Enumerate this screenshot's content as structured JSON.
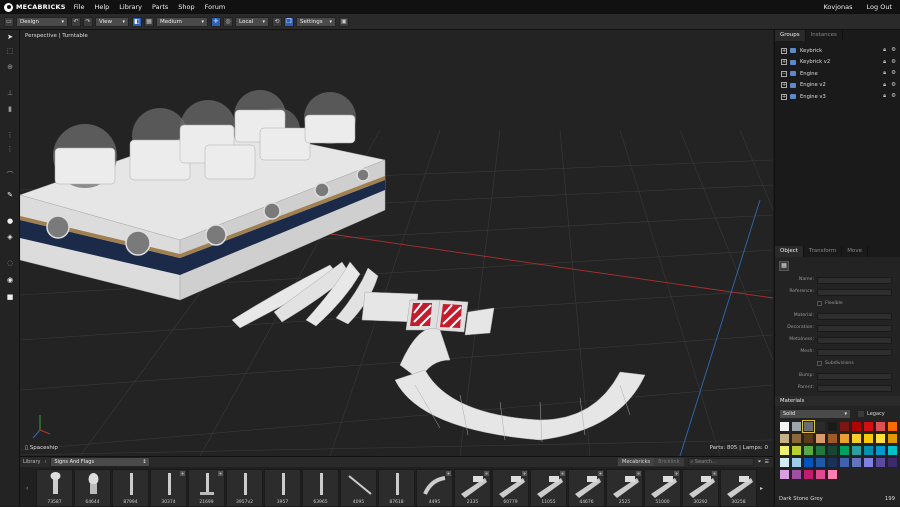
{
  "app": {
    "name": "MECABRICKS"
  },
  "menu": {
    "items": [
      "File",
      "Help",
      "Library",
      "Parts",
      "Shop",
      "Forum"
    ],
    "user": "Kovjonas",
    "logout": "Log Out"
  },
  "toolbar": {
    "mode": "Design",
    "view": "View",
    "quality": "Medium",
    "space": "Local",
    "settings": "Settings"
  },
  "viewport": {
    "label": "Perspective | Turntable",
    "model_name": "Spaceship",
    "stats": "Parts: 805 | Lamps: 0"
  },
  "groups": {
    "tabs": [
      "Groups",
      "Instances"
    ],
    "items": [
      {
        "label": "Keybrick",
        "expand": "+"
      },
      {
        "label": "Keybrick v2",
        "expand": "+"
      },
      {
        "label": "Engine",
        "expand": "−"
      },
      {
        "label": "Engine v2",
        "expand": "+"
      },
      {
        "label": "Engine v3",
        "expand": "+"
      }
    ]
  },
  "object": {
    "tabs": [
      "Object",
      "Transform",
      "Move"
    ],
    "fields": [
      "Name:",
      "Reference:",
      "Flexible",
      "Material:",
      "Decoration:",
      "Metalness:",
      "Mesh:",
      "Subdivisions",
      "Bump:",
      "Parent:"
    ]
  },
  "materials": {
    "title": "Materials",
    "mode": "Solid",
    "legacy": "Legacy",
    "selected_name": "Dark Stone Grey",
    "selected_count": "199",
    "colors": [
      "#f4f4f4",
      "#a0a5a9",
      "#6b6e70",
      "#2b2b2b",
      "#1b1b1b",
      "#7b1712",
      "#b40000",
      "#d01012",
      "#e05050",
      "#ff6a00",
      "#c7b08a",
      "#8a6a3a",
      "#5a3a1a",
      "#d79a6a",
      "#a05a2a",
      "#e8a030",
      "#f5cd2f",
      "#fac80a",
      "#ffe040",
      "#e09a00",
      "#f0f070",
      "#b8d030",
      "#58ab41",
      "#237841",
      "#184632",
      "#00a060",
      "#2aa0a0",
      "#0090b0",
      "#009ad0",
      "#00bfc8",
      "#d0ecf0",
      "#9ccce8",
      "#0055bf",
      "#1e5aa8",
      "#19325a",
      "#4060b0",
      "#6074c0",
      "#8080e0",
      "#5a4aa0",
      "#3c2a6a",
      "#d8a0e0",
      "#a050a0",
      "#c41c6c",
      "#e04890",
      "#ff80b0"
    ]
  },
  "library": {
    "crumb": "Library",
    "category": "Signs And Flags",
    "source_1": "Mecabricks",
    "source_2": "Bricklink",
    "search_placeholder": "Search...",
    "parts": [
      "73587",
      "64644",
      "87994",
      "30374",
      "21699",
      "3957v2",
      "3957",
      "63965",
      "4095",
      "87618",
      "4495",
      "2335",
      "60779",
      "11055",
      "44676",
      "2525",
      "51000",
      "30292",
      "30258"
    ]
  }
}
